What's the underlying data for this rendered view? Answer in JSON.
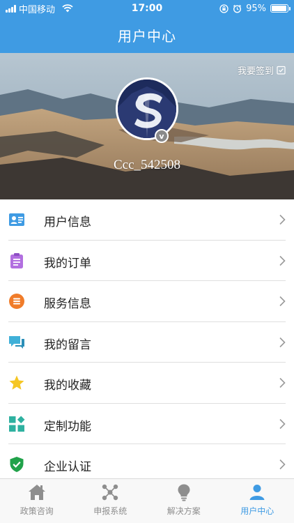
{
  "status_bar": {
    "carrier": "中国移动",
    "time": "17:00",
    "battery_percent": "95%",
    "battery_level": 0.95
  },
  "nav": {
    "title": "用户中心"
  },
  "profile": {
    "sign_in_label": "我要签到",
    "username": "Ccc_542508",
    "badge": "v"
  },
  "menu": {
    "items": [
      {
        "label": "用户信息",
        "icon": "user-card-icon"
      },
      {
        "label": "我的订单",
        "icon": "clipboard-icon"
      },
      {
        "label": "服务信息",
        "icon": "list-circle-icon"
      },
      {
        "label": "我的留言",
        "icon": "chat-bubbles-icon"
      },
      {
        "label": "我的收藏",
        "icon": "star-icon"
      },
      {
        "label": "定制功能",
        "icon": "custom-blocks-icon"
      },
      {
        "label": "企业认证",
        "icon": "shield-check-icon"
      }
    ]
  },
  "tabs": {
    "items": [
      {
        "label": "政策咨询",
        "icon": "house-icon"
      },
      {
        "label": "申报系统",
        "icon": "nodes-icon"
      },
      {
        "label": "解决方案",
        "icon": "lightbulb-icon"
      },
      {
        "label": "用户中心",
        "icon": "person-icon"
      }
    ],
    "active_index": 3
  },
  "colors": {
    "primary": "#3f9be3",
    "tab_inactive": "#8e8e8e",
    "divider": "#dedede"
  }
}
